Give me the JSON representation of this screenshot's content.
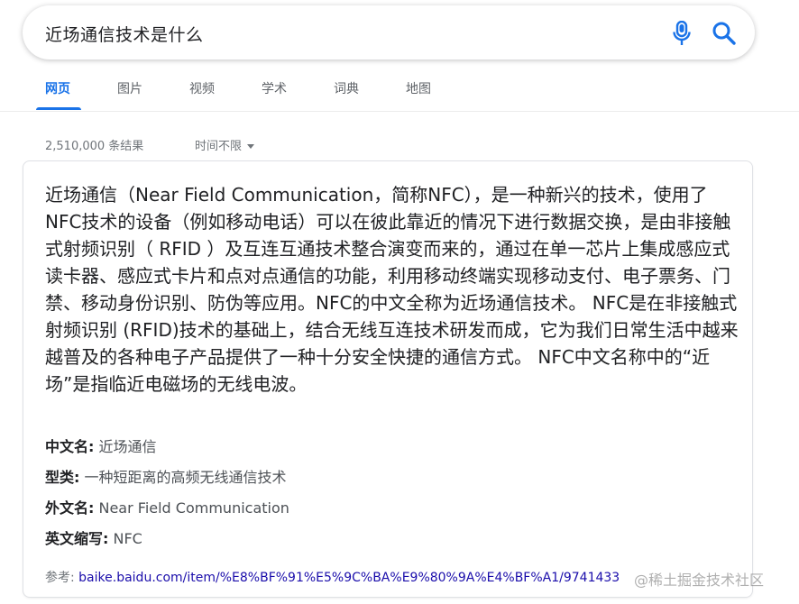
{
  "search": {
    "query": "近场通信技术是什么"
  },
  "tabs": [
    {
      "label": "网页",
      "active": true
    },
    {
      "label": "图片",
      "active": false
    },
    {
      "label": "视频",
      "active": false
    },
    {
      "label": "学术",
      "active": false
    },
    {
      "label": "词典",
      "active": false
    },
    {
      "label": "地图",
      "active": false
    }
  ],
  "results": {
    "count_text": "2,510,000 条结果",
    "time_filter": "时间不限"
  },
  "answer": {
    "description": "近场通信（Near Field Communication，简称NFC），是一种新兴的技术，使用了NFC技术的设备（例如移动电话）可以在彼此靠近的情况下进行数据交换，是由非接触式射频识别（ RFID ）及互连互通技术整合演变而来的，通过在单一芯片上集成感应式读卡器、感应式卡片和点对点通信的功能，利用移动终端实现移动支付、电子票务、门禁、移动身份识别、防伪等应用。NFC的中文全称为近场通信技术。 NFC是在非接触式射频识别 (RFID)技术的基础上，结合无线互连技术研发而成，它为我们日常生活中越来越普及的各种电子产品提供了一种十分安全快捷的通信方式。 NFC中文名称中的“近场”是指临近电磁场的无线电波。",
    "facts": [
      {
        "label": "中文名:",
        "value": " 近场通信"
      },
      {
        "label": "型类:",
        "value": " 一种短距离的高频无线通信技术"
      },
      {
        "label": "外文名:",
        "value": " Near Field Communication"
      },
      {
        "label": "英文缩写:",
        "value": " NFC"
      }
    ],
    "source_prefix": "参考: ",
    "source_url": "baike.baidu.com/item/%E8%BF%91%E5%9C%BA%E9%80%9A%E4%BF%A1/9741433"
  },
  "watermark": "@稀土掘金技术社区",
  "colors": {
    "accent": "#1a73e8",
    "link": "#1a0dab",
    "mic_blue": "#4285f4",
    "search_icon": "#1a73e8"
  },
  "icons": {
    "mic": "microphone-icon",
    "search": "search-icon"
  }
}
